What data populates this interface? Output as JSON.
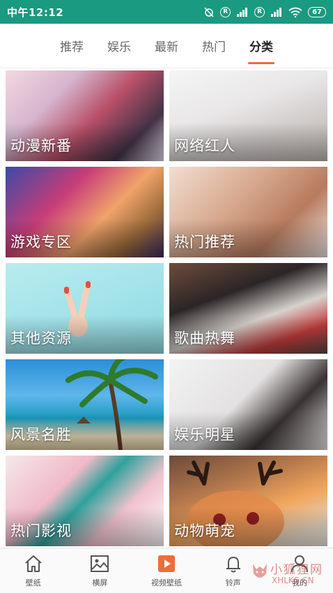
{
  "status": {
    "time": "中午12:12",
    "r1": "R",
    "r2": "R",
    "battery": "67"
  },
  "tabs": [
    {
      "label": "推荐",
      "active": false
    },
    {
      "label": "娱乐",
      "active": false
    },
    {
      "label": "最新",
      "active": false
    },
    {
      "label": "热门",
      "active": false
    },
    {
      "label": "分类",
      "active": true
    }
  ],
  "categories": [
    {
      "label": "动漫新番"
    },
    {
      "label": "网络红人"
    },
    {
      "label": "游戏专区"
    },
    {
      "label": "热门推荐"
    },
    {
      "label": "其他资源"
    },
    {
      "label": "歌曲热舞"
    },
    {
      "label": "风景名胜"
    },
    {
      "label": "娱乐明星"
    },
    {
      "label": "热门影视"
    },
    {
      "label": "动物萌宠"
    }
  ],
  "bottom_nav": [
    {
      "label": "壁纸",
      "icon": "home-icon"
    },
    {
      "label": "横屏",
      "icon": "image-icon"
    },
    {
      "label": "视频壁纸",
      "icon": "video-icon"
    },
    {
      "label": "铃声",
      "icon": "bell-icon"
    },
    {
      "label": "我的",
      "icon": "user-icon"
    }
  ],
  "watermark": {
    "title": "小狐狸网",
    "url": "XHLKS.CN"
  },
  "colors": {
    "status_bar": "#1a9a80",
    "accent": "#ef6c3a"
  }
}
